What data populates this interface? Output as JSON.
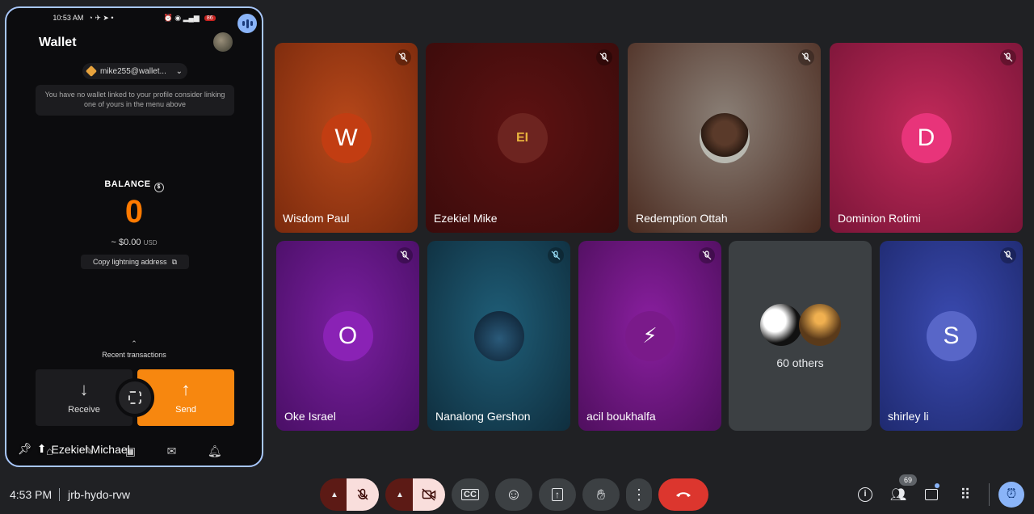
{
  "phone": {
    "status_time": "10:53 AM",
    "status_battery": "86",
    "wallet_title": "Wallet",
    "account": "mike255@wallet...",
    "notice": "You have no wallet linked to your profile consider linking one of yours in the menu above",
    "balance_label": "BALANCE",
    "balance_value": "0",
    "balance_usd": "~ $0.00",
    "balance_currency": "USD",
    "copy_label": "Copy lightning address",
    "recent_label": "Recent transactions",
    "receive_label": "Receive",
    "send_label": "Send",
    "presenter_label": "Ezekiel Michael"
  },
  "tiles": [
    {
      "name": "Wisdom Paul",
      "initial": "W"
    },
    {
      "name": "Ezekiel Mike",
      "initial": "EI"
    },
    {
      "name": "Redemption Ottah",
      "initial": ""
    },
    {
      "name": "Dominion Rotimi",
      "initial": "D"
    },
    {
      "name": "Oke Israel",
      "initial": "O"
    },
    {
      "name": "Nanalong Gershon",
      "initial": ""
    },
    {
      "name": "acil boukhalfa",
      "initial": ""
    },
    {
      "name": "60 others",
      "initial": ""
    },
    {
      "name": "shirley li",
      "initial": "S"
    }
  ],
  "bottom": {
    "time": "4:53 PM",
    "meeting_code": "jrb-hydo-rvw",
    "participants_count": "69"
  },
  "icons": [
    "mic-off-icon",
    "camera-off-icon",
    "captions-icon",
    "emoji-icon",
    "present-icon",
    "raise-hand-icon",
    "more-icon",
    "hangup-icon",
    "info-icon",
    "people-icon",
    "chat-icon",
    "activities-icon",
    "host-controls-icon"
  ]
}
